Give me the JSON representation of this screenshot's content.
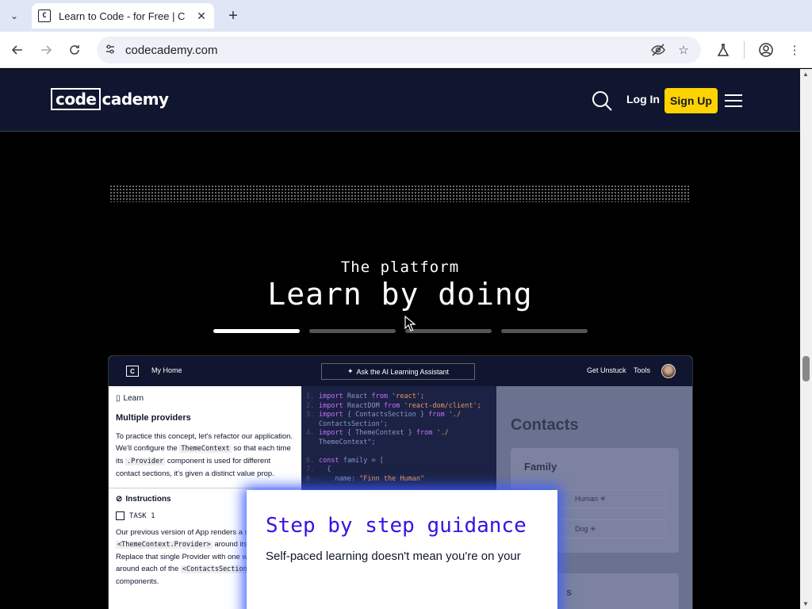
{
  "browser": {
    "tab_title": "Learn to Code - for Free | C",
    "favicon_text": "C",
    "url": "codecademy.com",
    "icons": [
      "tab-list-icon",
      "close-icon",
      "new-tab-icon",
      "back-icon",
      "forward-icon",
      "reload-icon",
      "site-info-icon",
      "eye-off-icon",
      "star-icon",
      "flask-icon",
      "profile-icon",
      "more-icon"
    ]
  },
  "header": {
    "logo_box": "code",
    "logo_rest": "cademy",
    "login_label": "Log In",
    "signup_label": "Sign Up",
    "colors": {
      "background": "#10162f",
      "signup": "#ffd300"
    }
  },
  "hero": {
    "eyebrow": "The platform",
    "headline": "Learn by doing",
    "progress": {
      "total": 4,
      "active_index": 0
    }
  },
  "mockup": {
    "topbar": {
      "logo": "C",
      "home": "My Home",
      "ai_button": "Ask the AI Learning Assistant",
      "unstuck": "Get Unstuck",
      "tools": "Tools"
    },
    "learn": {
      "label": "Learn",
      "lesson_title": "Multiple providers",
      "body_1": "To practice this concept, let's refactor our application. We'll configure the",
      "code_1": "ThemeContext",
      "body_2": "so that each time its",
      "code_2": ".Provider",
      "body_3": "component is used for different contact sections, it's given a distinct value prop.",
      "instructions": "Instructions",
      "task_label": "TASK 1",
      "task_1": "Our previous version of App renders a single",
      "task_code_1": "<ThemeContext.Provider>",
      "task_2": "around its children. Replace that single Provider with one wrapped around each of",
      "task_3": "the",
      "task_code_2": "<ContactsSection>",
      "task_4": "components."
    },
    "code_lines": [
      {
        "n": "1.",
        "kw": "import",
        "rest": " React ",
        "kw2": "from",
        "str": " 'react';"
      },
      {
        "n": "2.",
        "kw": "import",
        "rest": " ReactDOM ",
        "kw2": "from",
        "str": " 'react-dom/client';"
      },
      {
        "n": "3.",
        "kw": "import",
        "rest": " { ContactsSection } ",
        "kw2": "from",
        "str": " './"
      },
      {
        "n": "",
        "kw": "",
        "rest": "ContactsSection';",
        "kw2": "",
        "str": ""
      },
      {
        "n": "4.",
        "kw": "import",
        "rest": " { ThemeContext } ",
        "kw2": "from",
        "str": " './"
      },
      {
        "n": "",
        "kw": "",
        "rest": "ThemeContext\";",
        "kw2": "",
        "str": ""
      },
      {
        "n": "",
        "kw": "",
        "rest": "",
        "kw2": "",
        "str": ""
      },
      {
        "n": "6.",
        "kw": "const",
        "rest": " family = [",
        "kw2": "",
        "str": ""
      },
      {
        "n": "7.",
        "kw": "",
        "rest": "  {",
        "kw2": "",
        "str": ""
      },
      {
        "n": "8.",
        "kw": "",
        "rest": "    name: ",
        "kw2": "",
        "str": "\"Finn the Human\""
      }
    ],
    "preview": {
      "contacts_title": "Contacts",
      "family_title": "Family",
      "row_1": "Human ✳",
      "row_2": "Dog ✳",
      "section_2_title": "s"
    }
  },
  "guide_card": {
    "title": "Step by step guidance",
    "text": "Self-paced learning doesn't mean you're on your"
  }
}
